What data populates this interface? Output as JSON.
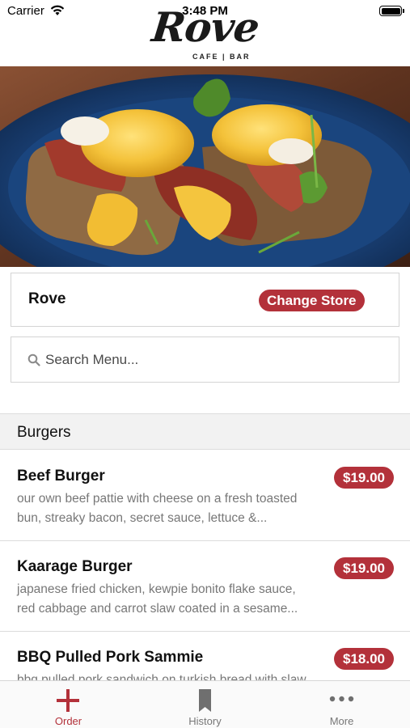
{
  "status_bar": {
    "carrier": "Carrier",
    "time": "3:48 PM"
  },
  "header": {
    "logo_text": "Rove",
    "logo_sub": "CAFE | BAR"
  },
  "store": {
    "name": "Rove",
    "change_label": "Change Store"
  },
  "search": {
    "placeholder": "Search Menu..."
  },
  "menu": {
    "category": "Burgers",
    "items": [
      {
        "name": "Beef Burger",
        "desc_line1": "our own beef pattie with cheese on a fresh toasted",
        "desc_line2": "bun, streaky bacon, secret sauce, lettuce &...",
        "price": "$19.00"
      },
      {
        "name": "Kaarage Burger",
        "desc_line1": "japanese fried chicken, kewpie bonito flake sauce,",
        "desc_line2": "red cabbage and carrot slaw coated in a sesame...",
        "price": "$19.00"
      },
      {
        "name": "BBQ Pulled Pork Sammie",
        "desc_line1": "bbq pulled pork sandwich on turkish bread with slaw",
        "desc_line2": "",
        "price": "$18.00"
      }
    ]
  },
  "tabs": [
    {
      "label": "Order",
      "icon": "plus-icon",
      "active": true
    },
    {
      "label": "History",
      "icon": "bookmark-icon",
      "active": false
    },
    {
      "label": "More",
      "icon": "more-dots-icon",
      "active": false
    }
  ],
  "colors": {
    "accent": "#b3313a",
    "muted_text": "#777777",
    "divider": "#dcdcdc"
  }
}
